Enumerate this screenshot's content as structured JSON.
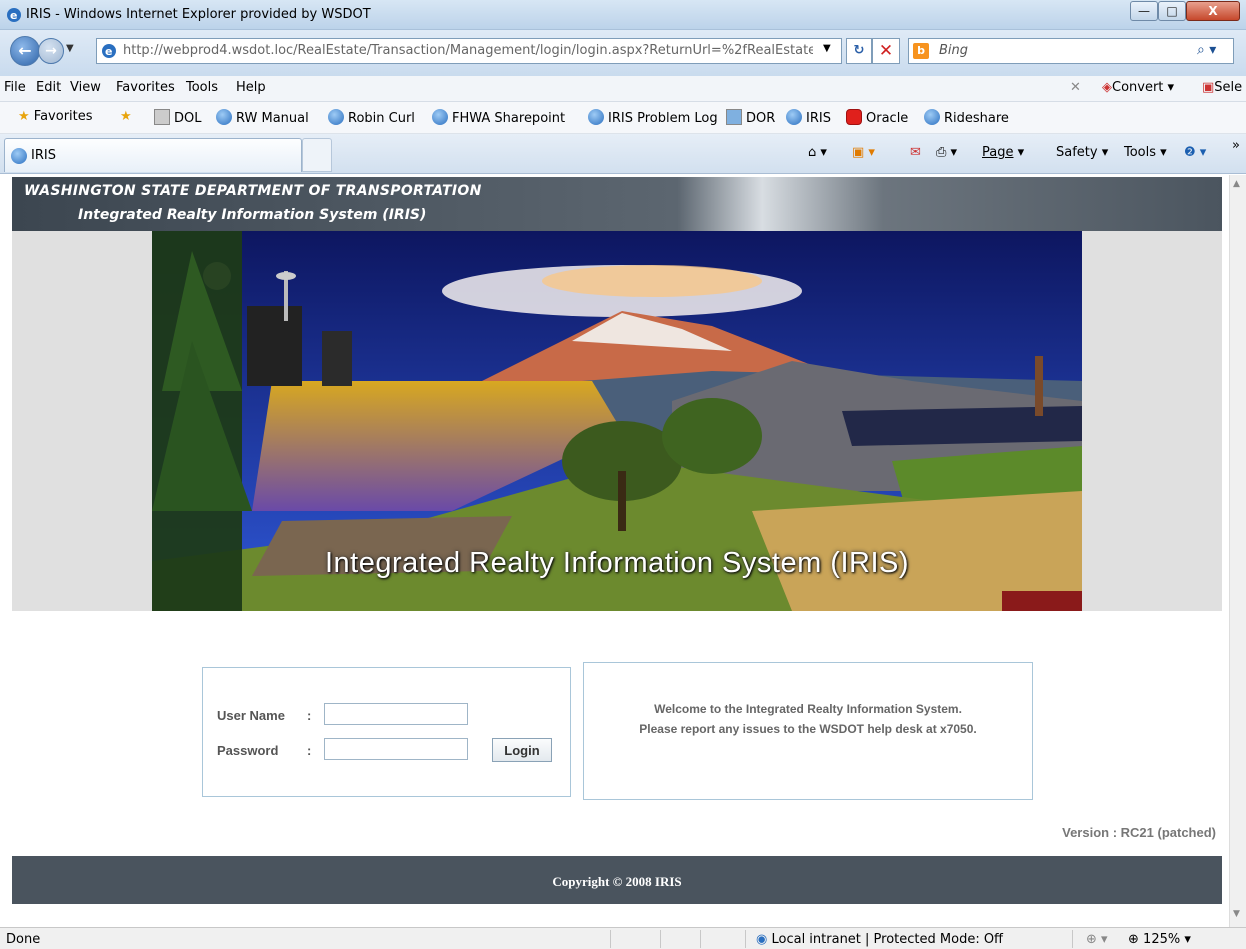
{
  "window": {
    "title": "IRIS - Windows Internet Explorer provided by WSDOT",
    "min": "—",
    "max": "□",
    "close": "X"
  },
  "address": {
    "url": "http://webprod4.wsdot.loc/RealEstate/Transaction/Management/login/login.aspx?ReturnUrl=%2fRealEstate",
    "search_placeholder": "Bing"
  },
  "menu": [
    "File",
    "Edit",
    "View",
    "Favorites",
    "Tools",
    "Help"
  ],
  "toolbar_right": {
    "convert": "Convert",
    "select": "Sele"
  },
  "favorites": {
    "label": "Favorites",
    "items": [
      "DOL",
      "RW Manual",
      "Robin Curl",
      "FHWA Sharepoint",
      "IRIS Problem Log",
      "DOR",
      "IRIS",
      "Oracle",
      "Rideshare"
    ]
  },
  "tab": {
    "title": "IRIS"
  },
  "commands": {
    "page": "Page",
    "safety": "Safety",
    "tools": "Tools"
  },
  "header": {
    "line1": "WASHINGTON STATE DEPARTMENT OF TRANSPORTATION",
    "line2": "Integrated Realty Information System (IRIS)"
  },
  "banner": {
    "caption": "Integrated Realty Information System (IRIS)"
  },
  "login": {
    "username_label": "User Name",
    "password_label": "Password",
    "colon": ":",
    "username_value": "",
    "password_value": "",
    "button": "Login"
  },
  "welcome": {
    "line1": "Welcome to the Integrated Realty Information System.",
    "line2": "Please report any issues to the WSDOT help desk at x7050."
  },
  "version": "Version : RC21 (patched)",
  "footer": {
    "copyright": "Copyright © 2008 IRIS"
  },
  "status": {
    "text": "Done",
    "zone": "Local intranet | Protected Mode: Off",
    "zoom": "125%"
  },
  "colors": {
    "header_bg": "#4a545e",
    "accent_border": "#a9c6d9",
    "banner_sky": "#1a2a8a"
  }
}
